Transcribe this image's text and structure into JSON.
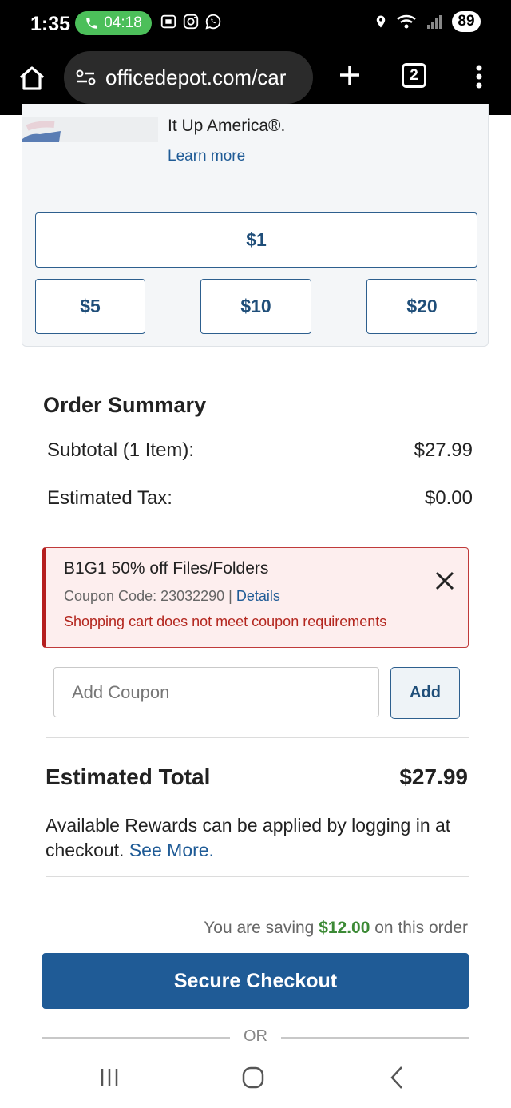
{
  "status_bar": {
    "time": "1:35",
    "call_timer": "04:18",
    "battery": "89"
  },
  "browser": {
    "url": "officedepot.com/car",
    "tab_count": "2"
  },
  "donation": {
    "text_fragment": "It Up America®.",
    "learn_more": "Learn more",
    "amounts": [
      "$1",
      "$5",
      "$10",
      "$20"
    ]
  },
  "order_summary": {
    "title": "Order Summary",
    "subtotal_label": "Subtotal (1 Item):",
    "subtotal_value": "$27.99",
    "tax_label": "Estimated Tax:",
    "tax_value": "$0.00"
  },
  "coupon_alert": {
    "name": "B1G1 50% off Files/Folders",
    "code_text": "Coupon Code: 23032290 | ",
    "details_link": "Details",
    "error": "Shopping cart does not meet coupon requirements"
  },
  "coupon_entry": {
    "placeholder": "Add Coupon",
    "add_label": "Add"
  },
  "total": {
    "label": "Estimated Total",
    "value": "$27.99"
  },
  "rewards": {
    "text": "Available Rewards can be applied by logging in at checkout. ",
    "link": "See More."
  },
  "saving": {
    "prefix": "You are saving ",
    "amount": "$12.00",
    "suffix": " on this order"
  },
  "checkout": {
    "label": "Secure Checkout",
    "or_text": "OR"
  },
  "colors": {
    "brand_blue": "#1f5b96",
    "error_red": "#b3261e",
    "saving_green": "#3c8a35",
    "call_green": "#4cbf5a"
  }
}
